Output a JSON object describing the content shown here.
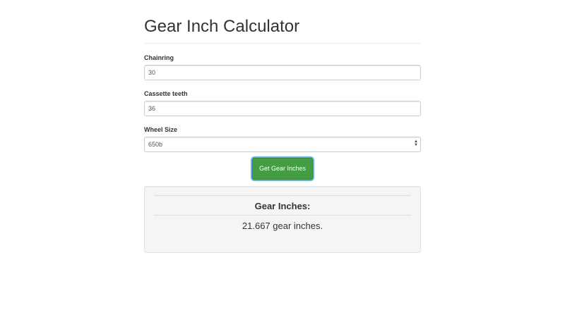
{
  "page": {
    "title": "Gear Inch Calculator"
  },
  "form": {
    "chainring": {
      "label": "Chainring",
      "value": "30"
    },
    "cassette": {
      "label": "Cassette teeth",
      "value": "36"
    },
    "wheel_size": {
      "label": "Wheel Size",
      "selected": "650b"
    },
    "submit_label": "Get Gear Inches"
  },
  "result": {
    "heading": "Gear Inches:",
    "text": "21.667 gear inches."
  },
  "colors": {
    "button_bg": "#449d44",
    "button_focus_ring": "#66afe9",
    "well_bg": "#f5f5f5"
  }
}
